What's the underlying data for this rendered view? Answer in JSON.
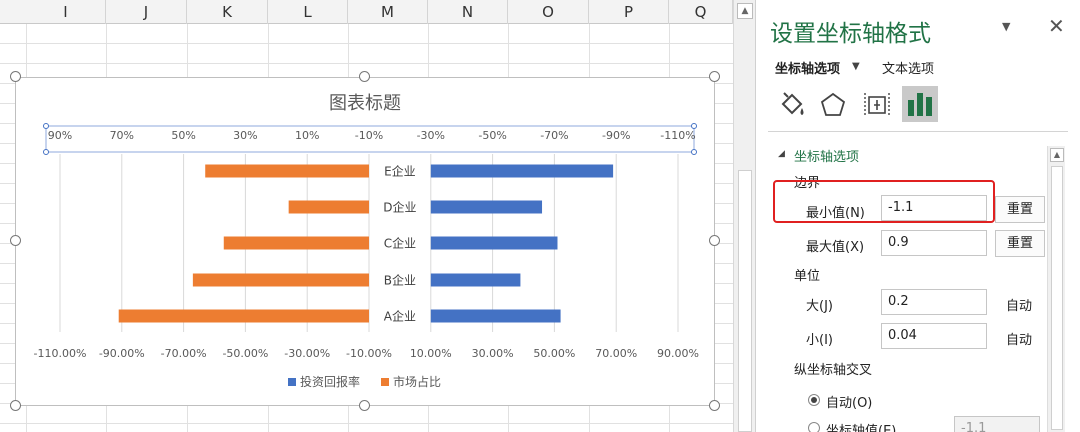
{
  "sheet": {
    "columns": [
      "I",
      "J",
      "K",
      "L",
      "M",
      "N",
      "O",
      "P",
      "Q"
    ]
  },
  "chart": {
    "title": "图表标题",
    "top_axis_labels": [
      "90%",
      "70%",
      "50%",
      "30%",
      "10%",
      "-10%",
      "-30%",
      "-50%",
      "-70%",
      "-90%",
      "-110%"
    ],
    "bottom_axis_labels": [
      "-110.00%",
      "-90.00%",
      "-70.00%",
      "-50.00%",
      "-30.00%",
      "-10.00%",
      "10.00%",
      "30.00%",
      "50.00%",
      "70.00%",
      "90.00%"
    ],
    "legend": {
      "series_blue": "投资回报率",
      "series_orange": "市场占比"
    }
  },
  "chart_data": {
    "type": "bar",
    "orientation": "horizontal",
    "categories": [
      "E企业",
      "D企业",
      "C企业",
      "B企业",
      "A企业"
    ],
    "series": [
      {
        "name": "投资回报率",
        "color": "#4472c4",
        "values": [
          0.59,
          0.36,
          0.41,
          0.29,
          0.42
        ]
      },
      {
        "name": "市场占比",
        "color": "#ed7d31",
        "values": [
          0.53,
          0.26,
          0.47,
          0.57,
          0.81
        ]
      }
    ],
    "primary_axis": {
      "min": -1.1,
      "max": 0.9,
      "reversed": true
    },
    "secondary_axis": {
      "min": -1.1,
      "max": 0.9
    },
    "legend_position": "bottom",
    "grid": true
  },
  "pane": {
    "title": "设置坐标轴格式",
    "tab_axis_options": "坐标轴选项",
    "tab_text_options": "文本选项",
    "section_title": "坐标轴选项",
    "bounds_label": "边界",
    "min_label": "最小值(N)",
    "min_value": "-1.1",
    "max_label": "最大值(X)",
    "max_value": "0.9",
    "reset": "重置",
    "units_label": "单位",
    "major_label": "大(J)",
    "major_value": "0.2",
    "minor_label": "小(I)",
    "minor_value": "0.04",
    "auto": "自动",
    "cross_label": "纵坐标轴交叉",
    "cross_auto": "自动(O)",
    "cross_value_label": "坐标轴值(E)",
    "cross_value": "-1.1"
  },
  "colors": {
    "accent_green": "#217346",
    "bar_blue": "#4472c4",
    "bar_orange": "#ed7d31",
    "highlight_red": "#e02020"
  }
}
